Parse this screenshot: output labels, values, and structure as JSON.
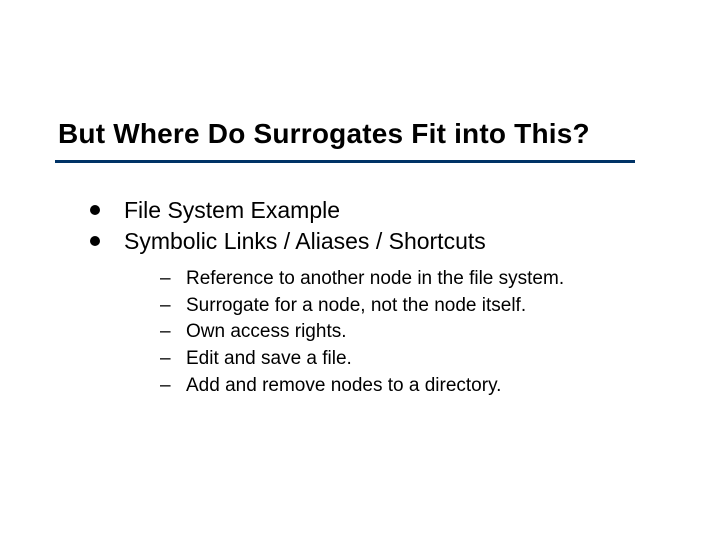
{
  "title": "But Where Do Surrogates Fit into This?",
  "bullets": {
    "l1a": "File System Example",
    "l1b": "Symbolic Links / Aliases / Shortcuts"
  },
  "sub": {
    "s1": "Reference to another node in the file system.",
    "s2": "Surrogate for a node, not the node itself.",
    "s3": "Own access rights.",
    "s4": "Edit and save a file.",
    "s5": "Add and remove nodes to a directory."
  },
  "dash": "–"
}
